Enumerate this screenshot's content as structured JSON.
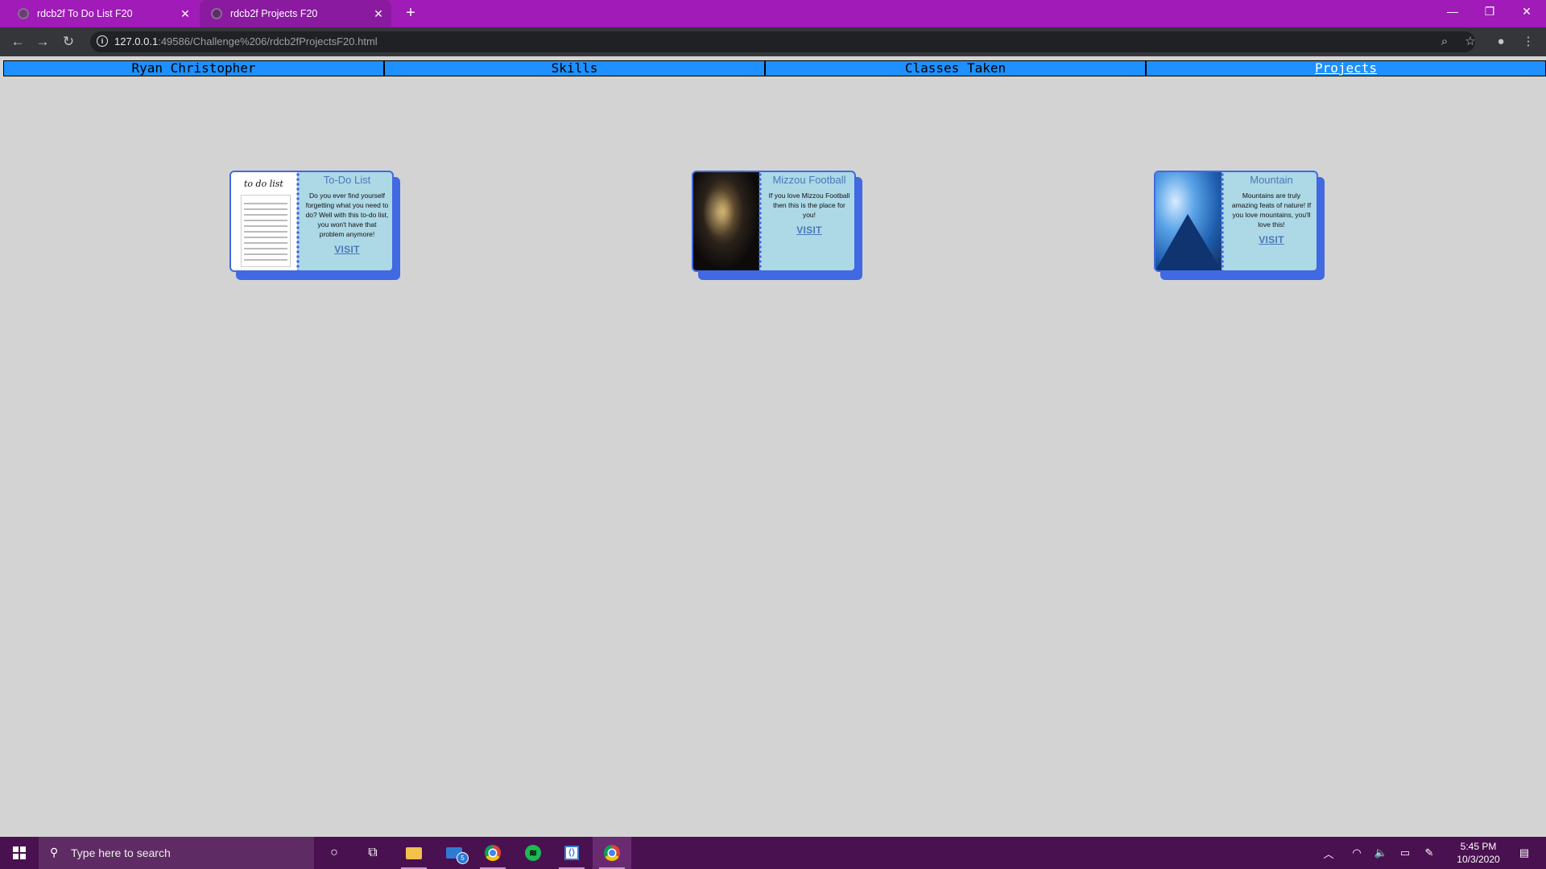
{
  "browser": {
    "tabs": [
      {
        "title": "rdcb2f To Do List F20",
        "close": "✕"
      },
      {
        "title": "rdcb2f Projects F20",
        "close": "✕"
      }
    ],
    "new_tab": "+",
    "window_controls": {
      "minimize": "—",
      "restore": "❐",
      "close": "✕"
    },
    "url_host": "127.0.0.1",
    "url_rest": ":49586/Challenge%206/rdcb2fProjectsF20.html"
  },
  "nav": [
    {
      "label": "Ryan Christopher",
      "active": false
    },
    {
      "label": "Skills",
      "active": false
    },
    {
      "label": "Classes Taken",
      "active": false
    },
    {
      "label": "Projects",
      "active": true
    }
  ],
  "cards": [
    {
      "title": "To-Do List",
      "desc": "Do you ever find yourself forgetting what you need to do? Well with this to-do list, you won't have that problem anymore!",
      "link": "VISIT",
      "image_text": "to do list"
    },
    {
      "title": "Mizzou Football",
      "desc": "If you love Mizzou Football then this is the place for you!",
      "link": "VISIT"
    },
    {
      "title": "Mountain",
      "desc": "Mountains are truly amazing feats of nature! If you love mountains, you'll love this!",
      "link": "VISIT"
    }
  ],
  "taskbar": {
    "search_placeholder": "Type here to search",
    "mail_badge": "5",
    "time": "5:45 PM",
    "date": "10/3/2020"
  },
  "colors": {
    "tabstrip": "#a01bb8",
    "nav_bar": "#1e90ff",
    "card_bg": "#add8e6",
    "card_accent": "#4169e1",
    "page_bg": "#d3d3d3",
    "taskbar": "#4a1150"
  }
}
